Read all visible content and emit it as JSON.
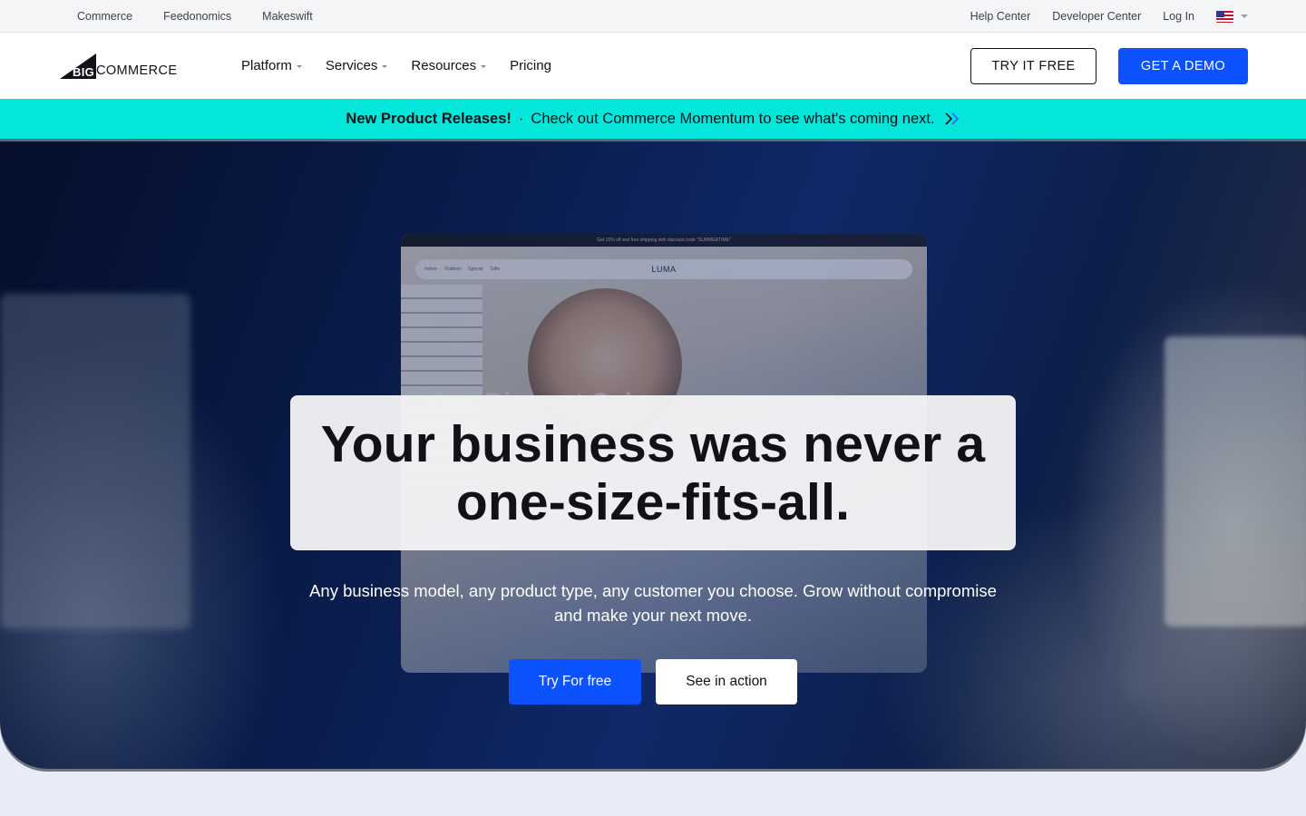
{
  "utility_bar": {
    "left_links": [
      "Commerce",
      "Feedonomics",
      "Makeswift"
    ],
    "right_links": [
      "Help Center",
      "Developer Center",
      "Log In"
    ],
    "locale_icon": "us-flag-icon"
  },
  "nav": {
    "logo": {
      "big": "BIG",
      "commerce": "COMMERCE"
    },
    "items": [
      {
        "label": "Platform",
        "has_dropdown": true
      },
      {
        "label": "Services",
        "has_dropdown": true
      },
      {
        "label": "Resources",
        "has_dropdown": true
      },
      {
        "label": "Pricing",
        "has_dropdown": false
      }
    ],
    "try_free_label": "TRY IT FREE",
    "demo_label": "GET A DEMO"
  },
  "announcement": {
    "title": "New Product Releases!",
    "separator": "·",
    "message": "Check out Commerce Momentum to see what's coming next.",
    "icon": "double-chevron-right-icon"
  },
  "hero": {
    "headline": "Your business was never a one-size-fits-all.",
    "subtext": "Any business model, any product type, any customer you choose. Grow without compromise and make your next move.",
    "primary_cta": "Try For free",
    "secondary_cta": "See in action",
    "mock_store": {
      "promo": "Get 15% off and free shipping with discount code \"SUMMERTIME\"",
      "brand": "LUMA",
      "nav": [
        "Indoor",
        "Outdoor",
        "Special",
        "Gifts"
      ],
      "heading": "Our Biggest Sale"
    }
  },
  "colors": {
    "primary": "#0d52ff",
    "announcement_bg": "#03e6d9",
    "hero_bg": "#0a1d4e",
    "text": "#121118"
  }
}
